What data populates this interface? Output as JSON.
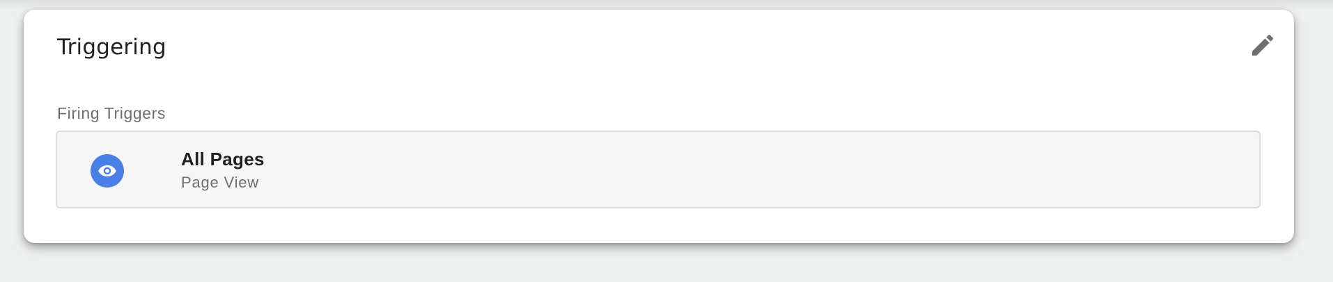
{
  "card": {
    "title": "Triggering",
    "edit_icon": "pencil-icon"
  },
  "firing_triggers": {
    "label": "Firing Triggers",
    "items": [
      {
        "name": "All Pages",
        "type": "Page View",
        "icon": "eye-icon",
        "icon_color": "#4a7fe8"
      }
    ]
  },
  "colors": {
    "background": "#eef0ef",
    "card": "#ffffff",
    "trigger_box": "#f6f6f6",
    "accent": "#4a7fe8"
  }
}
